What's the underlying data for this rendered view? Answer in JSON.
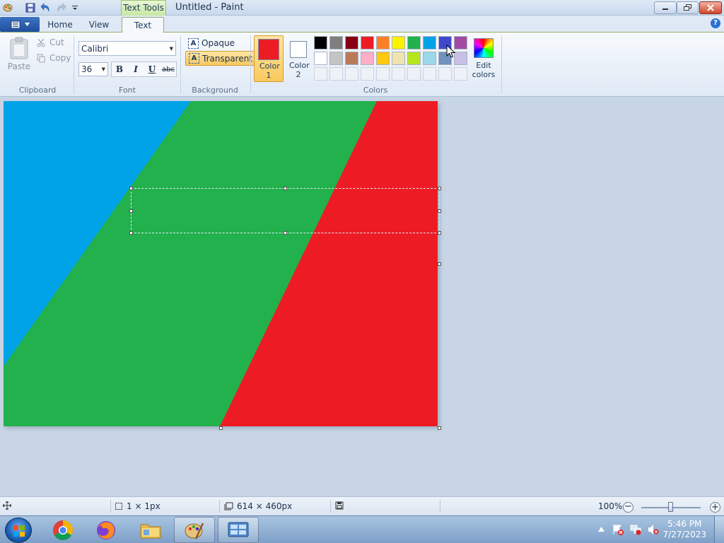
{
  "window": {
    "title": "Untitled - Paint",
    "contextual_tab": "Text Tools"
  },
  "tabs": [
    {
      "label": "Home",
      "active": false
    },
    {
      "label": "View",
      "active": false
    },
    {
      "label": "Text",
      "active": true
    }
  ],
  "ribbon": {
    "clipboard": {
      "group_label": "Clipboard",
      "paste": "Paste",
      "cut": "Cut",
      "copy": "Copy"
    },
    "font": {
      "group_label": "Font",
      "family": "Calibri",
      "size": "36",
      "bold": "B",
      "italic": "I",
      "underline": "U",
      "strikethrough": "abc"
    },
    "background": {
      "group_label": "Background",
      "opaque": "Opaque",
      "transparent": "Transparent",
      "selected": "Transparent",
      "glyph": "A"
    },
    "colors": {
      "group_label": "Colors",
      "color1_label": "Color 1",
      "color2_label": "Color 2",
      "color1": "#ed1c24",
      "color2": "#ffffff",
      "edit_colors": "Edit colors",
      "palette_row1": [
        "#000000",
        "#7f7f7f",
        "#880015",
        "#ed1c24",
        "#ff7f27",
        "#fff200",
        "#22b14c",
        "#00a2e8",
        "#3f48cc",
        "#a349a4"
      ],
      "palette_row2": [
        "#ffffff",
        "#c3c3c3",
        "#b97a57",
        "#ffaec9",
        "#ffc90e",
        "#efe4b0",
        "#b5e61d",
        "#99d9ea",
        "#7092be",
        "#c8bfe7"
      ]
    }
  },
  "canvas": {
    "image_colors": {
      "blue": "#00a2e8",
      "green": "#22b14c",
      "red": "#ed1c24"
    }
  },
  "statusbar": {
    "selection_size": "1 × 1px",
    "canvas_size": "614 × 460px",
    "zoom": "100%",
    "zoom_level_fraction": 0.5
  },
  "taskbar": {
    "apps": [
      "Google Chrome",
      "Firefox",
      "Windows Explorer",
      "Paint",
      "Control Panel"
    ],
    "time": "5:46 PM",
    "date": "7/27/2023"
  }
}
